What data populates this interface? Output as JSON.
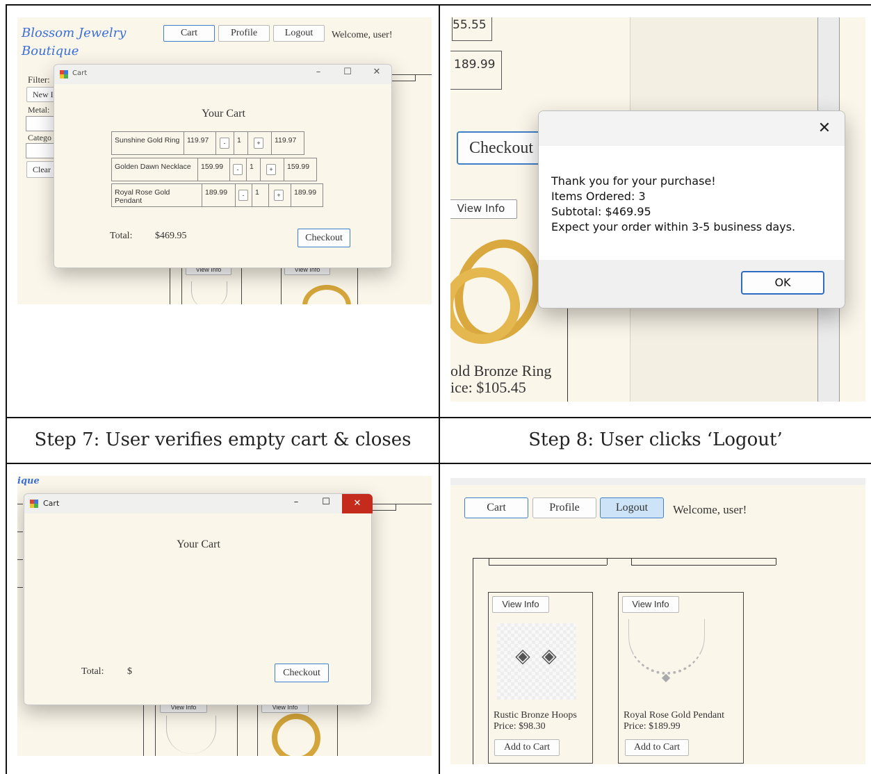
{
  "colors": {
    "cream": "#fbf6ea",
    "accent_blue": "#3f7fc9",
    "close_red": "#c42b1c",
    "logo_blue": "#3a6fd8"
  },
  "panel1": {
    "logo_line1": "Blossom Jewelry",
    "logo_line2": "Boutique",
    "nav": {
      "cart": "Cart",
      "profile": "Profile",
      "logout": "Logout"
    },
    "welcome": "Welcome, user!",
    "filter_label": "Filter:",
    "new_btn": "New I",
    "metal_label": "Metal:",
    "category_label": "Catego",
    "clear_btn": "Clear",
    "view_info": "View Info",
    "cart_window": {
      "title": "Cart",
      "heading": "Your Cart",
      "items": [
        {
          "name": "Sunshine Gold Ring",
          "price": "119.97",
          "minus": "-",
          "qty": "1",
          "plus": "+",
          "total": "119.97"
        },
        {
          "name": "Golden Dawn Necklace",
          "price": "159.99",
          "minus": "-",
          "qty": "1",
          "plus": "+",
          "total": "159.99"
        },
        {
          "name": "Royal Rose Gold Pendant",
          "price": "189.99",
          "minus": "-",
          "qty": "1",
          "plus": "+",
          "total": "189.99"
        }
      ],
      "total_label": "Total:",
      "total_value": "$469.95",
      "checkout": "Checkout"
    }
  },
  "panel2": {
    "partial_price_top": "55.55",
    "price_box": "189.99",
    "checkout": "Checkout",
    "view_info": "View Info",
    "product_name": "old Bronze Ring",
    "product_price": "ice: $105.45",
    "dialog": {
      "line1": "Thank you for your purchase!",
      "line2": "Items Ordered: 3",
      "line3": "Subtotal: $469.95",
      "line4": "Expect your order within 3-5 business days.",
      "ok": "OK"
    }
  },
  "captions": {
    "step7": "Step 7: User verifies empty cart & closes",
    "step8": "Step 8: User clicks ‘Logout’"
  },
  "panel3": {
    "logo_fragment": "ique",
    "cart_window": {
      "title": "Cart",
      "heading": "Your Cart",
      "total_label": "Total:",
      "total_value": "$",
      "checkout": "Checkout"
    },
    "view_info": "View Info"
  },
  "panel4": {
    "nav": {
      "cart": "Cart",
      "profile": "Profile",
      "logout": "Logout"
    },
    "welcome": "Welcome, user!",
    "products": [
      {
        "view_info": "View Info",
        "name": "Rustic Bronze Hoops",
        "price": "Price: $98.30",
        "add": "Add to Cart"
      },
      {
        "view_info": "View Info",
        "name": "Royal Rose Gold Pendant",
        "price": "Price: $189.99",
        "add": "Add to Cart"
      }
    ]
  }
}
